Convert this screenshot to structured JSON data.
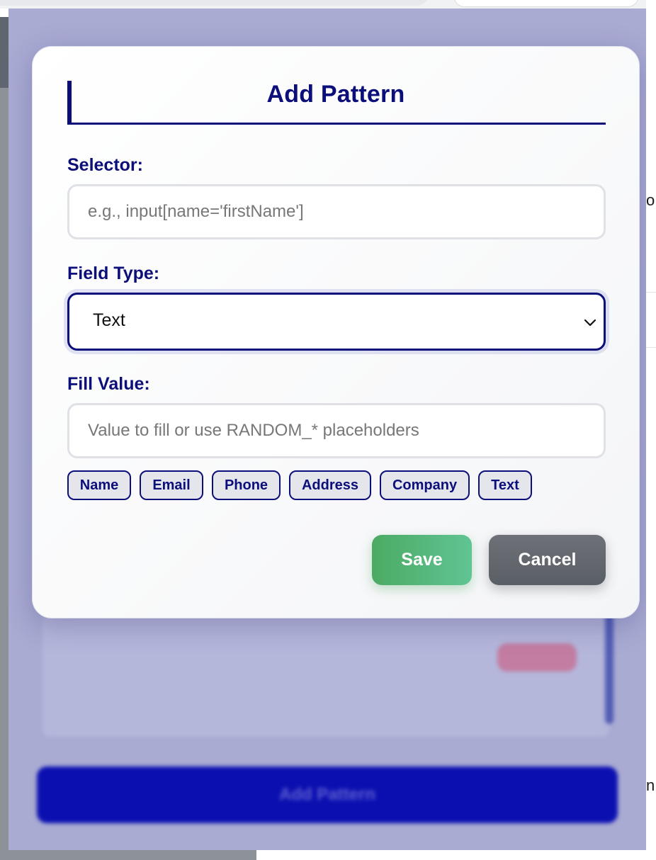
{
  "modal": {
    "title": "Add Pattern",
    "selector": {
      "label": "Selector:",
      "value": "",
      "placeholder": "e.g., input[name='firstName']"
    },
    "field_type": {
      "label": "Field Type:",
      "selected": "Text"
    },
    "fill_value": {
      "label": "Fill Value:",
      "value": "",
      "placeholder": "Value to fill or use RANDOM_* placeholders"
    },
    "quick_chips": [
      "Name",
      "Email",
      "Phone",
      "Address",
      "Company",
      "Text"
    ],
    "save_label": "Save",
    "cancel_label": "Cancel"
  },
  "background": {
    "add_button_label": "Add Pattern",
    "edge_chars": [
      "o",
      "n"
    ]
  },
  "colors": {
    "accent": "#0c0f7a",
    "save": "#4caa63",
    "cancel": "#6e7278",
    "overlay": "#a9abd3",
    "chip_bg": "#e4e6ec"
  },
  "icons": {
    "select_arrow": "chevron-down-icon"
  }
}
